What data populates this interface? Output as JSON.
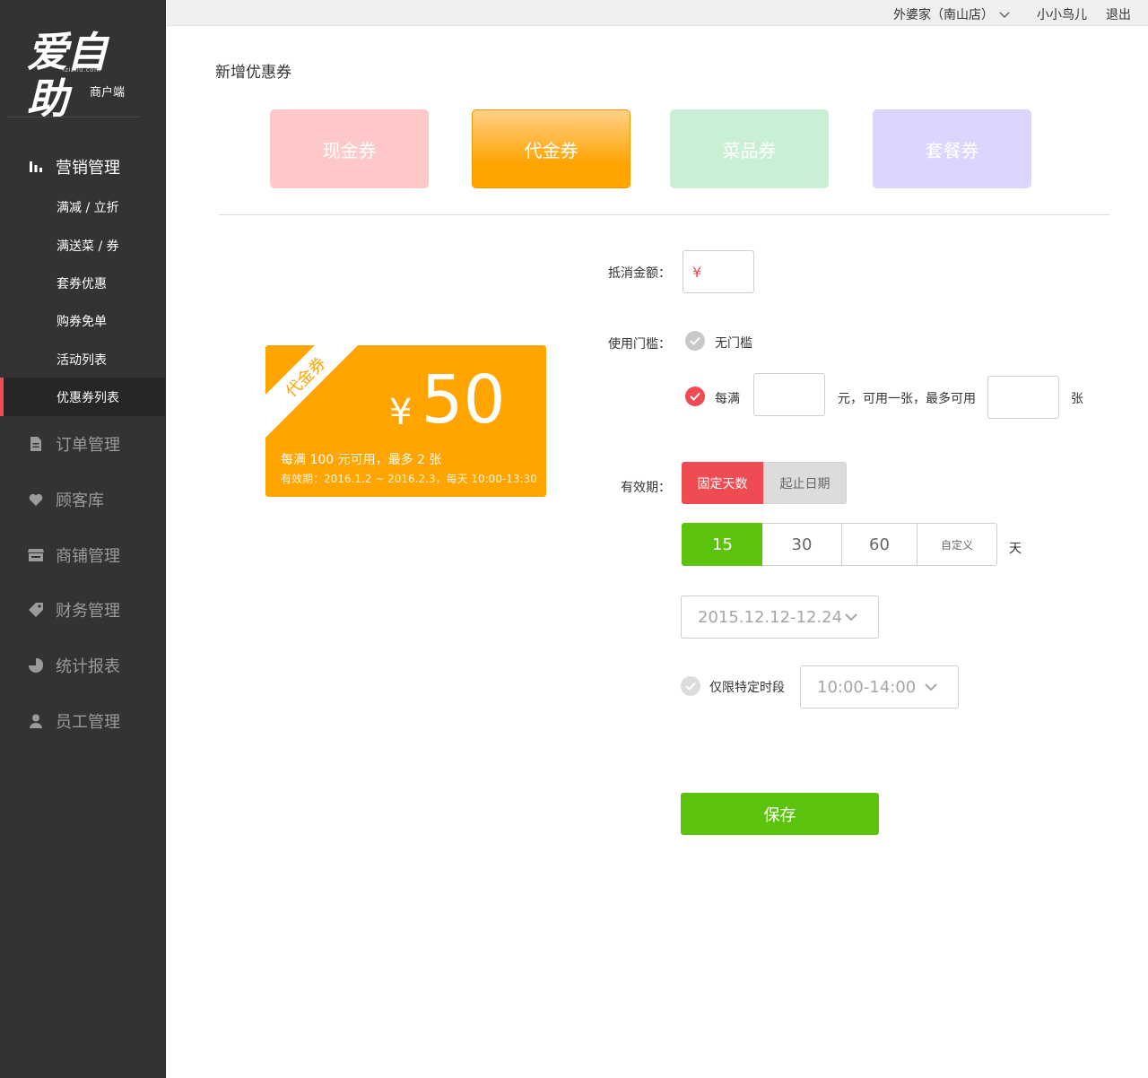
{
  "brand": {
    "logo_text": "爱自助",
    "logo_url": "izizhu.com",
    "subtitle": "商户端"
  },
  "topbar": {
    "store": "外婆家（南山店）",
    "user": "小小鸟儿",
    "logout": "退出"
  },
  "sidebar": {
    "groups": [
      {
        "label": "营销管理",
        "icon": "bar-chart-icon"
      },
      {
        "label": "订单管理",
        "icon": "document-icon"
      },
      {
        "label": "顾客库",
        "icon": "heart-icon"
      },
      {
        "label": "商铺管理",
        "icon": "store-icon"
      },
      {
        "label": "财务管理",
        "icon": "tag-icon"
      },
      {
        "label": "统计报表",
        "icon": "pie-chart-icon"
      },
      {
        "label": "员工管理",
        "icon": "user-icon"
      }
    ],
    "marketing_items": [
      "满减 / 立折",
      "满送菜 / 券",
      "套券优惠",
      "购券免单",
      "活动列表",
      "优惠券列表"
    ],
    "active_item": "优惠券列表"
  },
  "page": {
    "title": "新增优惠券"
  },
  "coupon_types": [
    {
      "label": "现金券",
      "color": "#fec8c9"
    },
    {
      "label": "代金券",
      "color": "#ffa400",
      "selected": true
    },
    {
      "label": "菜品券",
      "color": "#c9f0d4"
    },
    {
      "label": "套餐券",
      "color": "#dcd5fd"
    }
  ],
  "preview": {
    "ribbon": "代金券",
    "currency": "¥",
    "amount": "50",
    "rule": "每满 100 元可用，最多 2 张",
    "validity": "有效期：2016.1.2 ~ 2016.2.3，每天 10:00-13:30"
  },
  "form": {
    "offset_label": "抵消金额：",
    "offset_prefix": "¥",
    "threshold_label": "使用门槛：",
    "no_threshold": "无门槛",
    "per_full": "每满",
    "per_full_mid": "元，可用一张，最多可用",
    "per_full_unit": "张",
    "validity_label": "有效期：",
    "validity_modes": [
      "固定天数",
      "起止日期"
    ],
    "days_options": [
      "15",
      "30",
      "60",
      "自定义"
    ],
    "days_unit": "天",
    "date_range": "2015.12.12-12.24",
    "time_limit_label": "仅限特定时段",
    "time_range": "10:00-14:00",
    "save": "保存"
  },
  "colors": {
    "accent_red": "#ef4b53",
    "green": "#5bc30b",
    "orange": "#ffa400",
    "sidebar": "#333333"
  }
}
